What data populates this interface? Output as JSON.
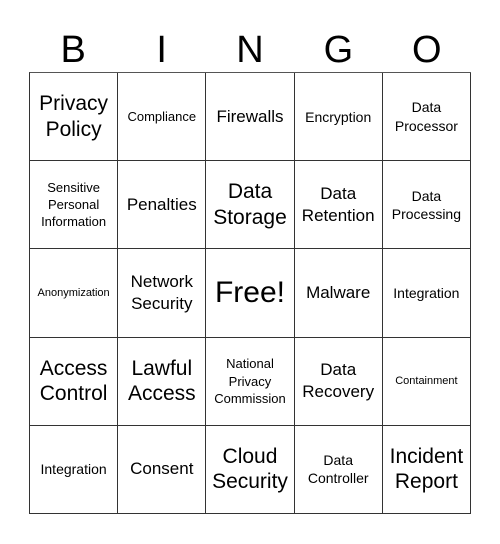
{
  "header": {
    "letters": [
      "B",
      "I",
      "N",
      "G",
      "O"
    ]
  },
  "card": {
    "rows": [
      [
        {
          "text": "Privacy Policy",
          "size": "l"
        },
        {
          "text": "Compliance",
          "size": "xs"
        },
        {
          "text": "Firewalls",
          "size": "m"
        },
        {
          "text": "Encryption",
          "size": "s"
        },
        {
          "text": "Data Processor",
          "size": "s"
        }
      ],
      [
        {
          "text": "Sensitive Personal Information",
          "size": "xs"
        },
        {
          "text": "Penalties",
          "size": "m"
        },
        {
          "text": "Data Storage",
          "size": "l"
        },
        {
          "text": "Data Retention",
          "size": "m"
        },
        {
          "text": "Data Processing",
          "size": "s"
        }
      ],
      [
        {
          "text": "Anonymization",
          "size": "xxs"
        },
        {
          "text": "Network Security",
          "size": "m"
        },
        {
          "text": "Free!",
          "size": "xl"
        },
        {
          "text": "Malware",
          "size": "m"
        },
        {
          "text": "Integration",
          "size": "s"
        }
      ],
      [
        {
          "text": "Access Control",
          "size": "l"
        },
        {
          "text": "Lawful Access",
          "size": "l"
        },
        {
          "text": "National Privacy Commission",
          "size": "xs"
        },
        {
          "text": "Data Recovery",
          "size": "m"
        },
        {
          "text": "Containment",
          "size": "xxs"
        }
      ],
      [
        {
          "text": "Integration",
          "size": "s"
        },
        {
          "text": "Consent",
          "size": "m"
        },
        {
          "text": "Cloud Security",
          "size": "l"
        },
        {
          "text": "Data Controller",
          "size": "s"
        },
        {
          "text": "Incident Report",
          "size": "l"
        }
      ]
    ]
  }
}
